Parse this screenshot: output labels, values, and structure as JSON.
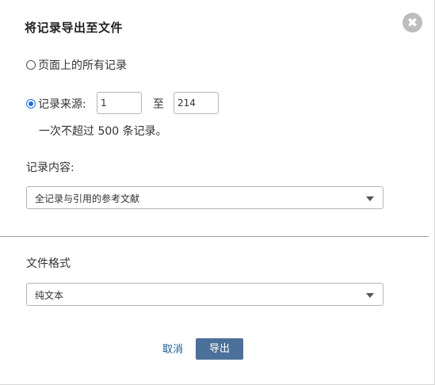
{
  "dialog": {
    "title": "将记录导出至文件",
    "close_icon": "close-icon",
    "close_glyph": "✖"
  },
  "range": {
    "option_all_label": "页面上的所有记录",
    "option_all_checked": false,
    "option_source_label": "记录来源:",
    "option_source_checked": true,
    "from_value": "1",
    "to_label": "至",
    "to_value": "214",
    "note": "一次不超过 500 条记录。"
  },
  "content": {
    "label": "记录内容:",
    "selected": "全记录与引用的参考文献"
  },
  "format": {
    "label": "文件格式",
    "selected": "纯文本"
  },
  "actions": {
    "cancel_label": "取消",
    "export_label": "导出"
  },
  "colors": {
    "accent": "#1a73d9",
    "button": "#4b7099",
    "link": "#1d5a8f"
  }
}
